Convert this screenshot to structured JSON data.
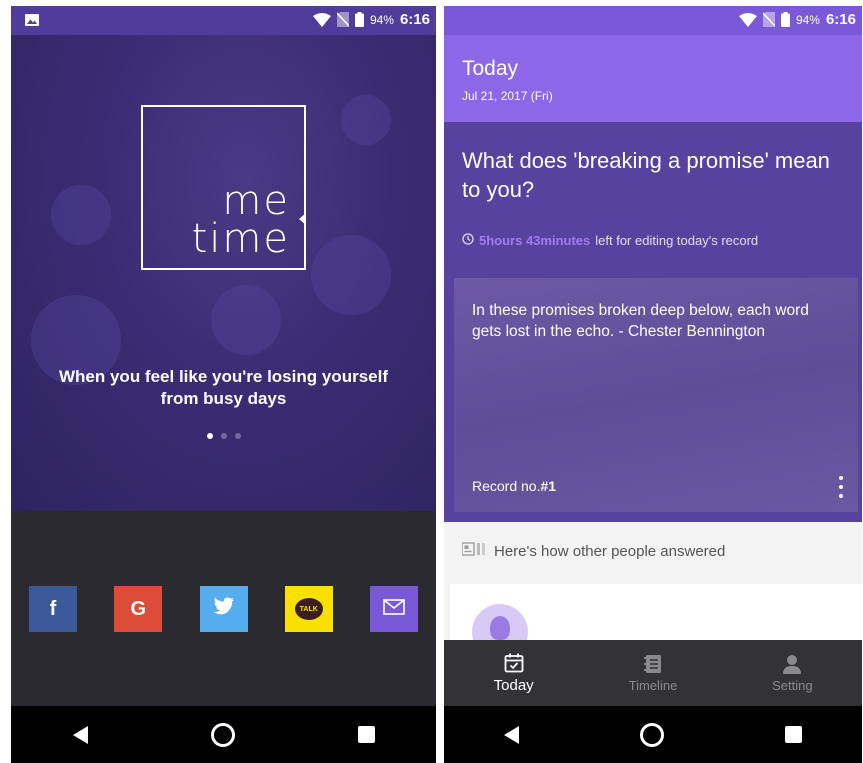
{
  "status": {
    "battery": "94%",
    "time": "6:16"
  },
  "onboarding": {
    "logo_line1": "me",
    "logo_line2": "time",
    "tagline": "When you feel like you're losing yourself from busy days",
    "pager": {
      "count": 3,
      "active": 0
    },
    "social": [
      {
        "name": "facebook",
        "glyph": "f",
        "icon": "facebook-icon",
        "color": "#3b5998"
      },
      {
        "name": "google",
        "glyph": "G",
        "icon": "google-icon",
        "color": "#dd4b39"
      },
      {
        "name": "twitter",
        "glyph": "",
        "icon": "twitter-bird-icon",
        "color": "#55acee"
      },
      {
        "name": "kakaotalk",
        "glyph": "TALK",
        "icon": "kakaotalk-icon",
        "color": "#f9e000"
      },
      {
        "name": "email",
        "glyph": "",
        "icon": "envelope-icon",
        "color": "#7a59d9"
      }
    ]
  },
  "today": {
    "title": "Today",
    "date": "Jul 21, 2017 (Fri)",
    "question": "What does 'breaking a promise' mean to you?",
    "timer_value": "5hours 43minutes",
    "timer_suffix": "left for editing today's record",
    "quote": "In these promises broken deep below, each word gets lost in the echo. - Chester Bennington",
    "record_label": "Record no.",
    "record_number": "#1",
    "others_label": "Here's how other people answered"
  },
  "tabs": [
    {
      "label": "Today",
      "icon": "calendar-check-icon",
      "active": true
    },
    {
      "label": "Timeline",
      "icon": "notebook-icon",
      "active": false
    },
    {
      "label": "Setting",
      "icon": "person-icon",
      "active": false
    }
  ],
  "colors": {
    "accent": "#8c68e8",
    "accent_dark": "#57429e",
    "timer_highlight": "#a47cf2",
    "tabbar": "#333336"
  }
}
